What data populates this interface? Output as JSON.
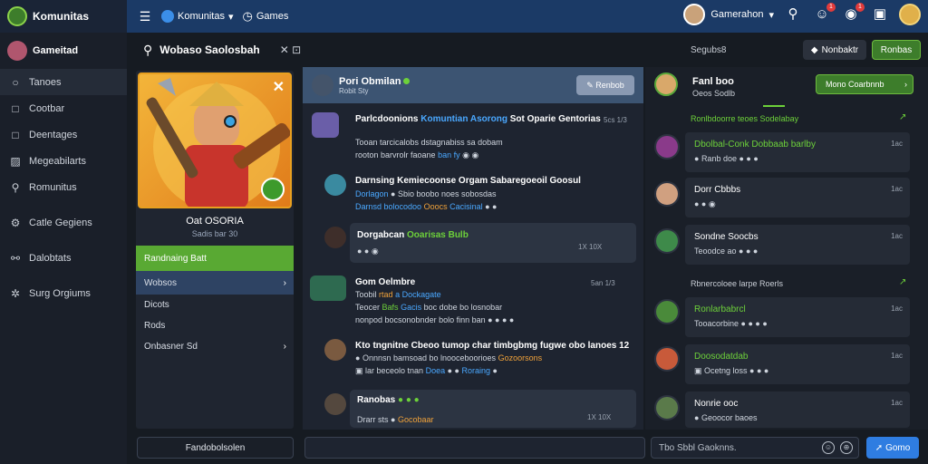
{
  "topbar": {
    "brand": "Komunitas",
    "nav_label": "Komunitas",
    "nav_second": "Games",
    "user_name": "Gamerahon",
    "badge1": "1",
    "badge2": "1"
  },
  "sidebar": {
    "profile_name": "Gameitad",
    "items": [
      {
        "label": "Tanoes",
        "icon": "circle-icon"
      },
      {
        "label": "Cootbar",
        "icon": "square-icon"
      },
      {
        "label": "Deentages",
        "icon": "square-icon"
      },
      {
        "label": "Megeabilarts",
        "icon": "image-icon"
      },
      {
        "label": "Romunitus",
        "icon": "search-icon"
      },
      {
        "label": "Catle Gegiens",
        "icon": "gear-icon"
      },
      {
        "label": "Dalobtats",
        "icon": "link-icon"
      },
      {
        "label": "Surg Orgiums",
        "icon": "settings-icon"
      }
    ]
  },
  "searchrow": {
    "title": "Wobaso Saolosbah",
    "right_label": "Segubs8",
    "btn_dark": "Nonbaktr",
    "btn_green": "Ronbas"
  },
  "profile": {
    "name": "Oat OSORIA",
    "sub": "Sadis bar 30",
    "menu": [
      {
        "label": "Randnaing Batt",
        "style": "green"
      },
      {
        "label": "Wobsos",
        "style": "sel"
      },
      {
        "label": "Dicots",
        "style": "plain"
      },
      {
        "label": "Rods",
        "style": "plain"
      },
      {
        "label": "Onbasner Sd",
        "style": "plain"
      }
    ]
  },
  "chat": {
    "header_name": "Pori Obmilan",
    "header_sub": "Robit Sty",
    "edit_label": "Renbob",
    "messages": [
      {
        "name": "Parlcdoonions",
        "name_green": "Komuntian Asorong",
        "name_rest": "Sot Oparie Gentorias",
        "time": "5cs 1/3",
        "line1": "Tooan tarcicalobs dstagnabiss sa dobam",
        "line2": "rooton barvrolr faoane",
        "line2_blue": "ban fy"
      },
      {
        "name": "Darnsing Kemiecoonse Orgam Sabaregoeoil Goosul",
        "time": "",
        "line1": "Dorlagon",
        "line1_rest": "Sbio boobo noes sobosdas",
        "line2": "Darnsd bolocodoo",
        "line2_orange": "Ooocs",
        "line2_blue": "Cacisinal"
      },
      {
        "name": "Dorgabcan",
        "name_green": "Ooarisas Bulb",
        "time": "1X 10X",
        "line1": "",
        "line2": ""
      },
      {
        "name": "Gom Oelmbre",
        "time": "5an 1/3",
        "line1": "Toobil",
        "line1_orange": "rtad",
        "line1_rest": "a Dockagate",
        "line2": "Teocer",
        "line2_green": "Bafs",
        "line2_blue": "Gacis",
        "line2_rest": "boc dobe bo losnobar",
        "line3": "nonpod bocsonobnder bolo finn ban"
      },
      {
        "name": "Kto tngnitne Cbeoo tumop char timbgbmg fugwe obo lanoes 12",
        "time": "",
        "line1": "Onnnsn bamsoad bo lnooceboorioes",
        "line1_orange": "Gozoorsons",
        "line2": "lar beceolo tnan",
        "line2_blue": "Doea",
        "line2_orange": "Roraing"
      },
      {
        "name": "Ranobas",
        "time": "1X 10X",
        "line1": "Drarr sts",
        "line1_orange": "Gocobaar"
      }
    ]
  },
  "right": {
    "head_name": "Fanl boo",
    "head_sub": "Oeos Sodlb",
    "head_btn": "Mono Coarbnnb",
    "section1": "Ronlbdoorre teoes Sodelabay",
    "section2": "Rbnercoloee larpe Roerls",
    "cards": [
      {
        "t1": "Dbolbal-Conk Dobbaab barlby",
        "green": true,
        "t2": "Ranb doe",
        "rt": "1ac"
      },
      {
        "t1": "Dorr Cbbbs",
        "green": false,
        "t2": "",
        "rt": "1ac"
      },
      {
        "t1": "Sondne Soocbs",
        "green": false,
        "t2": "Teoodce ao",
        "rt": "1ac"
      },
      {
        "t1": "Ronlarbabrcl",
        "green": true,
        "t2": "Tooacorbine",
        "rt": "1ac"
      },
      {
        "t1": "Doosodatdab",
        "green": true,
        "t2": "Ocetng loss",
        "rt": "1ac"
      },
      {
        "t1": "Nonrie ooc",
        "green": false,
        "t2": "Geoocor baoes",
        "rt": "1ac"
      }
    ]
  },
  "bottom": {
    "left_label": "Fandobolsolen",
    "right_placeholder": "Tbo Sbbl Gaoknns.",
    "send_label": "Gomo"
  },
  "colors": {
    "topbar": "#1b3a66",
    "accent_green": "#59a933",
    "accent_blue": "#2f7de1",
    "panel": "#1e2430"
  }
}
